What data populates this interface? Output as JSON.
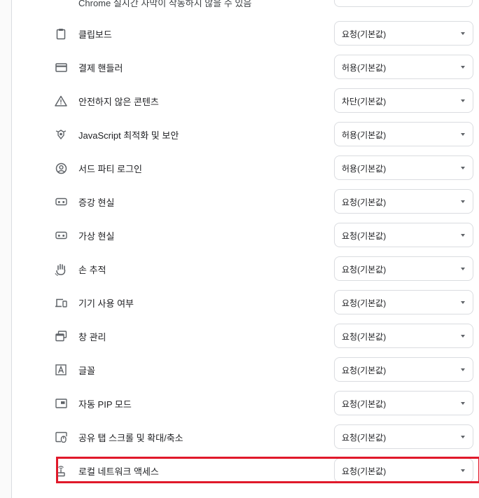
{
  "clipped_row": {
    "label": "Chrome 실시간 자막이 작동하지 않을 수 있음"
  },
  "rows": [
    {
      "icon": "clipboard-icon",
      "label": "클립보드",
      "value": "요청(기본값)"
    },
    {
      "icon": "credit-card-icon",
      "label": "결제 핸들러",
      "value": "허용(기본값)"
    },
    {
      "icon": "warning-icon",
      "label": "안전하지 않은 콘텐츠",
      "value": "차단(기본값)"
    },
    {
      "icon": "javascript-optimizer-icon",
      "label": "JavaScript 최적화 및 보안",
      "value": "허용(기본값)"
    },
    {
      "icon": "account-circle-icon",
      "label": "서드 파티 로그인",
      "value": "허용(기본값)"
    },
    {
      "icon": "vr-headset-icon",
      "label": "증강 현실",
      "value": "요청(기본값)"
    },
    {
      "icon": "vr-headset-icon",
      "label": "가상 현실",
      "value": "요청(기본값)"
    },
    {
      "icon": "hand-tracking-icon",
      "label": "손 추적",
      "value": "요청(기본값)"
    },
    {
      "icon": "devices-icon",
      "label": "기기 사용 여부",
      "value": "요청(기본값)"
    },
    {
      "icon": "window-management-icon",
      "label": "창 관리",
      "value": "요청(기본값)"
    },
    {
      "icon": "font-icon",
      "label": "글꼴",
      "value": "요청(기본값)"
    },
    {
      "icon": "picture-in-picture-icon",
      "label": "자동 PIP 모드",
      "value": "요청(기본값)"
    },
    {
      "icon": "shared-tab-scroll-icon",
      "label": "공유 탭 스크롤 및 확대/축소",
      "value": "요청(기본값)"
    },
    {
      "icon": "local-network-icon",
      "label": "로컬 네트워크 액세스",
      "value": "요청(기본값)"
    }
  ],
  "highlight_color": "#e0192a"
}
